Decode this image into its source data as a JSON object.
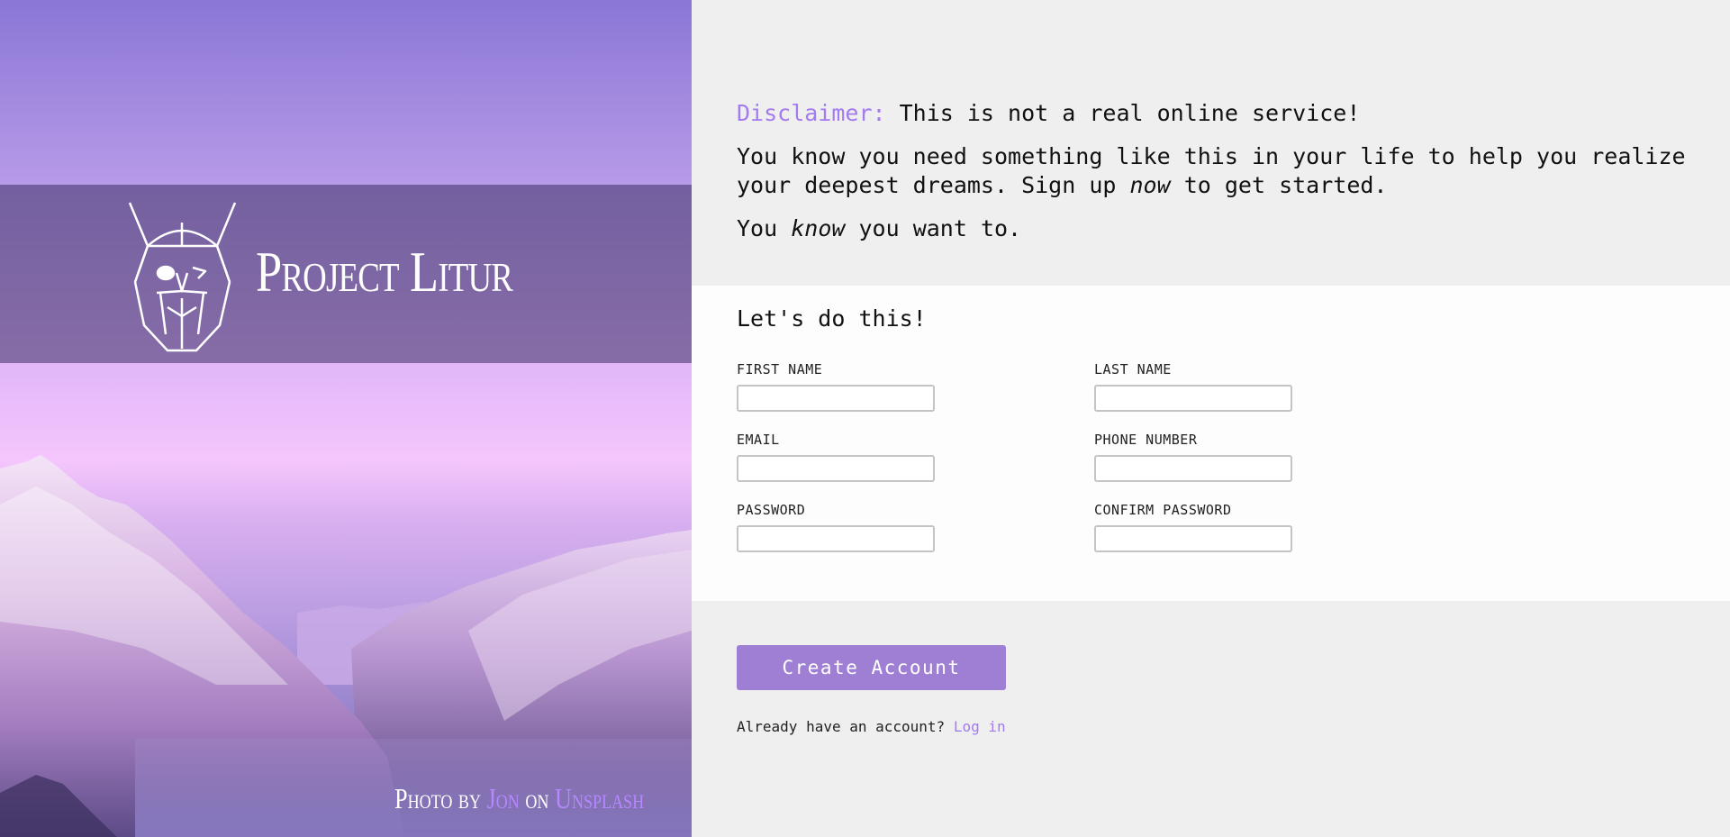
{
  "brand": {
    "name": "Project Litur",
    "logo_icon": "viking-helmet-bearded-face-icon"
  },
  "credit": {
    "prefix": "Photo by",
    "author": "Jon",
    "middle": "on",
    "site": "Unsplash"
  },
  "intro": {
    "disclaimer_label": "Disclaimer:",
    "disclaimer_text": " This is not a real online service!",
    "pitch_before": "You know you need something like this in your life to help you realize your deepest dreams. Sign up ",
    "pitch_emphasis": "now",
    "pitch_after": " to get started.",
    "know_before": "You ",
    "know_emphasis": "know",
    "know_after": " you want to."
  },
  "form": {
    "title": "Let's do this!",
    "fields": {
      "first_name": {
        "label": "FIRST NAME",
        "value": ""
      },
      "last_name": {
        "label": "LAST NAME",
        "value": ""
      },
      "email": {
        "label": "EMAIL",
        "value": ""
      },
      "phone": {
        "label": "PHONE NUMBER",
        "value": ""
      },
      "password": {
        "label": "PASSWORD",
        "value": ""
      },
      "confirm_password": {
        "label": "CONFIRM PASSWORD",
        "value": ""
      }
    }
  },
  "actions": {
    "create_label": "Create Account",
    "login_prompt": "Already have an account? ",
    "login_link": "Log in"
  },
  "colors": {
    "accent": "#a37bef",
    "button": "#9f7fd4",
    "panel_bg": "#efefef",
    "card_bg": "#fdfdfd"
  }
}
